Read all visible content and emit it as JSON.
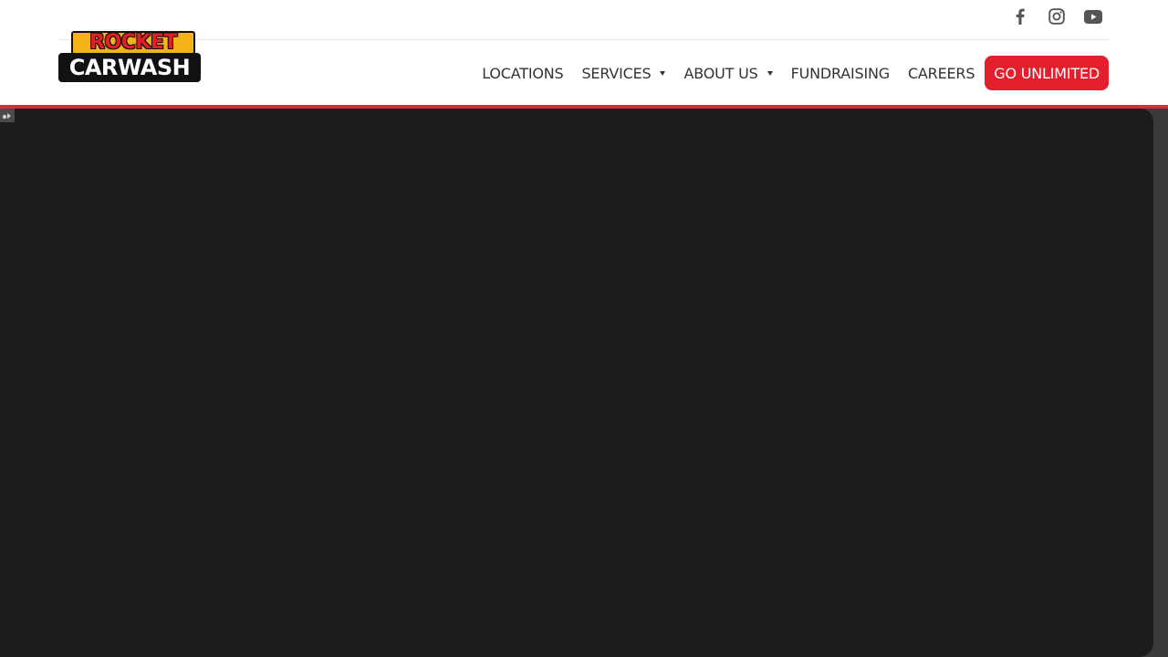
{
  "brand": {
    "logo_line1": "ROCKET",
    "logo_line2": "CARWASH",
    "accent_color": "#e31e2d",
    "logo_yellow": "#f6b21b"
  },
  "social": [
    {
      "name": "facebook",
      "icon": "facebook-icon"
    },
    {
      "name": "instagram",
      "icon": "instagram-icon"
    },
    {
      "name": "youtube",
      "icon": "youtube-icon"
    }
  ],
  "nav": {
    "items": [
      {
        "label": "LOCATIONS",
        "has_dropdown": false
      },
      {
        "label": "SERVICES",
        "has_dropdown": true
      },
      {
        "label": "ABOUT US",
        "has_dropdown": true
      },
      {
        "label": "FUNDRAISING",
        "has_dropdown": false
      },
      {
        "label": "CAREERS",
        "has_dropdown": false
      }
    ],
    "cta_label": "GO UNLIMITED"
  },
  "hero": {
    "background": "#1c1c1c"
  }
}
